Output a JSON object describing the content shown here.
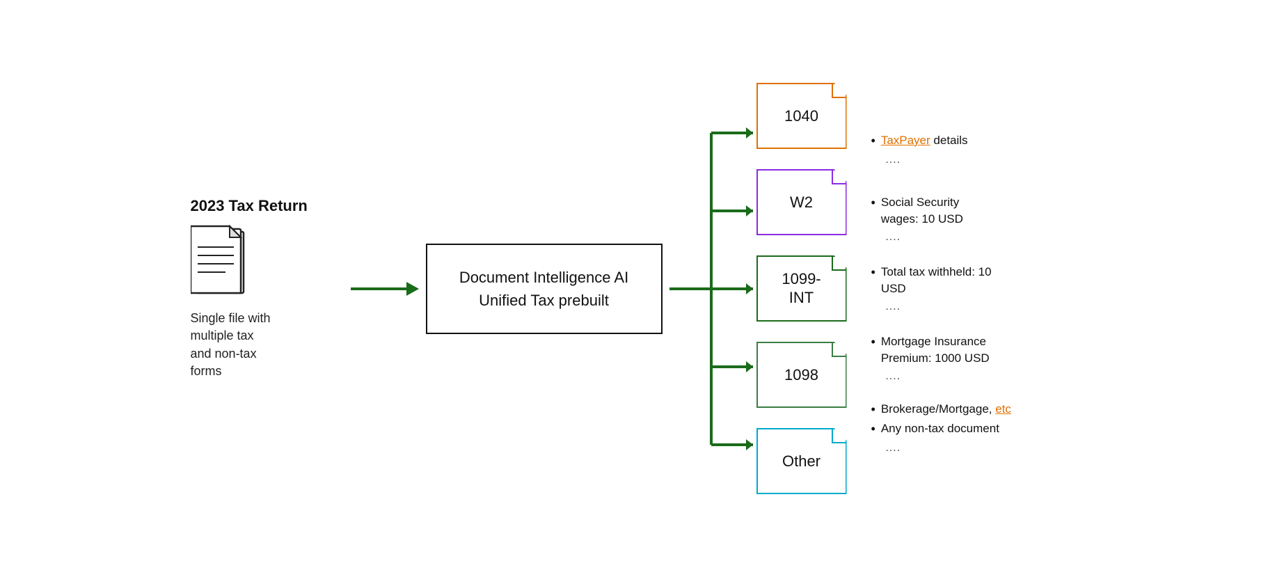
{
  "title": "2023 Tax Return",
  "docLabel": "Single file with\nmultiple tax\nand non-tax\nforms",
  "centerBox": {
    "line1": "Document Intelligence AI",
    "line2": "Unified Tax prebuilt"
  },
  "forms": [
    {
      "id": "1040",
      "label": "1040",
      "colorClass": "form-1040"
    },
    {
      "id": "w2",
      "label": "W2",
      "colorClass": "form-w2"
    },
    {
      "id": "1099-int",
      "label": "1099-\nINT",
      "colorClass": "form-1099"
    },
    {
      "id": "1098",
      "label": "1098",
      "colorClass": "form-1098"
    },
    {
      "id": "other",
      "label": "Other",
      "colorClass": "form-other"
    }
  ],
  "infoGroups": [
    {
      "items": [
        {
          "bullet": "•",
          "text": "TaxPayer details",
          "link": true,
          "linkPart": "TaxPayer"
        },
        {
          "bullet": "",
          "text": "....",
          "isDots": true
        }
      ]
    },
    {
      "items": [
        {
          "bullet": "•",
          "text": "Social Security wages: 10 USD"
        },
        {
          "bullet": "",
          "text": "....",
          "isDots": true
        }
      ]
    },
    {
      "items": [
        {
          "bullet": "•",
          "text": "Total tax withheld: 10 USD"
        },
        {
          "bullet": "",
          "text": "....",
          "isDots": true
        }
      ]
    },
    {
      "items": [
        {
          "bullet": "•",
          "text": "Mortgage Insurance Premium: 1000 USD"
        },
        {
          "bullet": "",
          "text": "....",
          "isDots": true
        }
      ]
    },
    {
      "items": [
        {
          "bullet": "•",
          "text": "Brokerage/Mortgage, etc",
          "link": true,
          "linkPart": "etc"
        },
        {
          "bullet": "•",
          "text": "Any non-tax document"
        },
        {
          "bullet": "",
          "text": "....",
          "isDots": true
        }
      ]
    }
  ],
  "colors": {
    "arrow": "#1a6b1a",
    "orange": "#e07000",
    "purple": "#8b2be2",
    "green": "#1a6b1a",
    "cyan": "#00aacc"
  }
}
